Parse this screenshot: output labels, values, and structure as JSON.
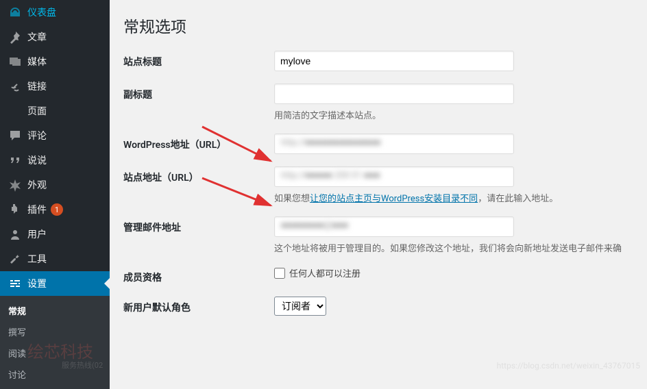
{
  "sidebar": {
    "items": [
      {
        "label": "仪表盘",
        "icon": "dashboard"
      },
      {
        "label": "文章",
        "icon": "pin"
      },
      {
        "label": "媒体",
        "icon": "media"
      },
      {
        "label": "链接",
        "icon": "link"
      },
      {
        "label": "页面",
        "icon": "page"
      },
      {
        "label": "评论",
        "icon": "comment"
      },
      {
        "label": "说说",
        "icon": "quote"
      },
      {
        "label": "外观",
        "icon": "appearance"
      },
      {
        "label": "插件",
        "icon": "plugin",
        "badge": "1"
      },
      {
        "label": "用户",
        "icon": "user"
      },
      {
        "label": "工具",
        "icon": "tool"
      },
      {
        "label": "设置",
        "icon": "settings",
        "current": true
      }
    ],
    "submenu": [
      {
        "label": "常规",
        "active": true
      },
      {
        "label": "撰写"
      },
      {
        "label": "阅读"
      },
      {
        "label": "讨论"
      }
    ]
  },
  "main": {
    "title": "常规选项",
    "fields": {
      "site_title": {
        "label": "站点标题",
        "value": "mylove"
      },
      "tagline": {
        "label": "副标题",
        "value": "",
        "description": "用简洁的文字描述本站点。"
      },
      "wp_url": {
        "label": "WordPress地址（URL）",
        "value": ""
      },
      "site_url": {
        "label": "站点地址（URL）",
        "value": "",
        "description_pre": "如果您想",
        "description_link": "让您的站点主页与WordPress安装目录不同",
        "description_post": "，请在此输入地址。"
      },
      "admin_email": {
        "label": "管理邮件地址",
        "value": "",
        "description": "这个地址将被用于管理目的。如果您修改这个地址，我们将会向新地址发送电子邮件来确"
      },
      "membership": {
        "label": "成员资格",
        "checkbox_label": "任何人都可以注册"
      },
      "default_role": {
        "label": "新用户默认角色",
        "selected": "订阅者"
      }
    }
  },
  "watermark": {
    "brand": "绘芯科技",
    "sub": "服务热线(02",
    "url": "https://blog.csdn.net/weixin_43767015"
  }
}
